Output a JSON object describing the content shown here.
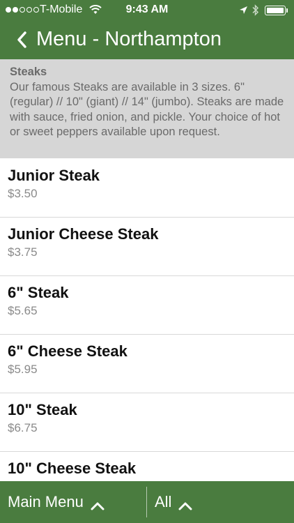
{
  "status_bar": {
    "carrier": "T-Mobile",
    "time": "9:43 AM",
    "signal_bars_filled": 2,
    "signal_bars_total": 5
  },
  "nav": {
    "title": "Menu - Northampton",
    "back_icon": "chevron-left-icon"
  },
  "category": {
    "title": "Steaks",
    "description": "Our famous Steaks are available in 3 sizes. 6\" (regular) // 10\" (giant) // 14\" (jumbo). Steaks are made with sauce, fried onion, and pickle. Your choice of hot or sweet peppers available upon request."
  },
  "items": [
    {
      "name": "Junior Steak",
      "price": "$3.50"
    },
    {
      "name": "Junior Cheese Steak",
      "price": "$3.75"
    },
    {
      "name": "6\" Steak",
      "price": "$5.65"
    },
    {
      "name": "6\" Cheese Steak",
      "price": "$5.95"
    },
    {
      "name": "10\" Steak",
      "price": "$6.75"
    },
    {
      "name": "10\" Cheese Steak",
      "price": ""
    }
  ],
  "bottom_bar": {
    "main_menu_label": "Main Menu",
    "filter_label": "All"
  },
  "colors": {
    "brand_green": "#4a7c3f",
    "category_bg": "#d6d6d6"
  }
}
